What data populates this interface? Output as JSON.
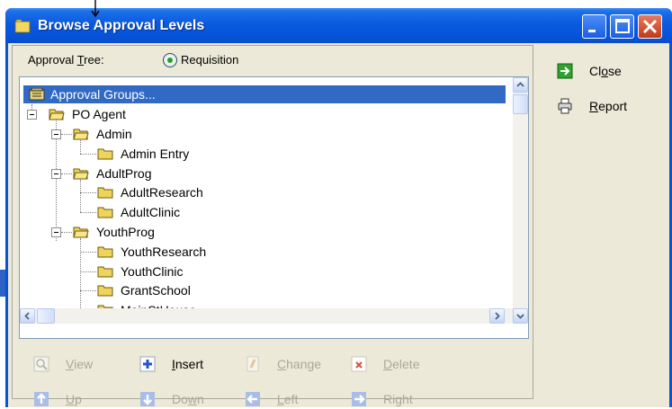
{
  "window": {
    "title": "Browse Approval Levels"
  },
  "approval_tree": {
    "label_prefix": "Approval ",
    "label_underlined": "T",
    "label_suffix": "ree:",
    "option_label": "Requisition"
  },
  "tree": {
    "root": "Approval Groups...",
    "nodes": [
      {
        "label": "PO Agent"
      },
      {
        "label": "Admin"
      },
      {
        "label": "Admin Entry"
      },
      {
        "label": "AdultProg"
      },
      {
        "label": "AdultResearch"
      },
      {
        "label": "AdultClinic"
      },
      {
        "label": "YouthProg"
      },
      {
        "label": "YouthResearch"
      },
      {
        "label": "YouthClinic"
      },
      {
        "label": "GrantSchool"
      },
      {
        "label": "MainStHouse"
      }
    ]
  },
  "side_buttons": {
    "close": {
      "first": "Cl",
      "u": "o",
      "rest": "se"
    },
    "report": {
      "first": "",
      "u": "R",
      "rest": "eport"
    }
  },
  "commands": {
    "view": {
      "first": "",
      "u": "V",
      "rest": "iew",
      "enabled": false
    },
    "insert": {
      "first": "",
      "u": "I",
      "rest": "nsert",
      "enabled": true
    },
    "change": {
      "first": "",
      "u": "C",
      "rest": "hange",
      "enabled": false
    },
    "delete": {
      "first": "",
      "u": "D",
      "rest": "elete",
      "enabled": false
    },
    "up": {
      "first": "",
      "u": "U",
      "rest": "p",
      "enabled": false
    },
    "down": {
      "first": "Do",
      "u": "w",
      "rest": "n",
      "enabled": false
    },
    "left": {
      "first": "",
      "u": "L",
      "rest": "eft",
      "enabled": false
    },
    "right": {
      "first": "Ri",
      "u": "g",
      "rest": "ht",
      "enabled": false
    }
  },
  "colors": {
    "title_blue": "#0553d8",
    "selection": "#316ac5",
    "window_face": "#ece9d8"
  }
}
